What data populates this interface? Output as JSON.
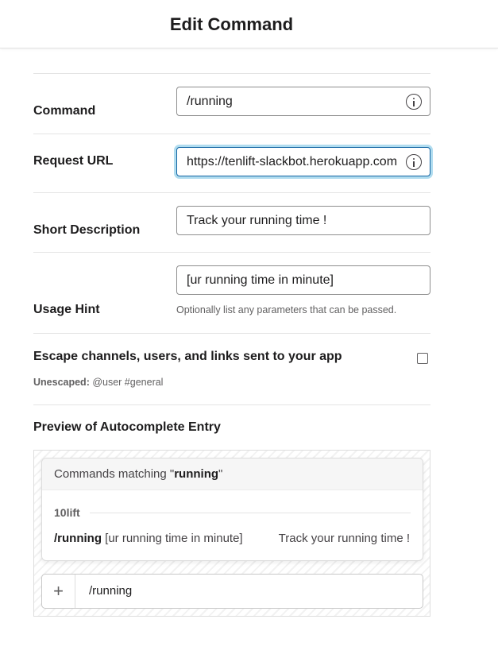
{
  "header": {
    "title": "Edit Command"
  },
  "form": {
    "command": {
      "label": "Command",
      "value": "/running"
    },
    "request_url": {
      "label": "Request URL",
      "value": "https://tenlift-slackbot.herokuapp.com"
    },
    "short_description": {
      "label": "Short Description",
      "value": "Track your running time !"
    },
    "usage_hint": {
      "label": "Usage Hint",
      "value": "[ur running time in minute]",
      "help": "Optionally list any parameters that can be passed."
    },
    "escape": {
      "label": "Escape channels, users, and links sent to your app",
      "sub_bold": "Unescaped:",
      "sub_text": " @user #general",
      "checked": false
    }
  },
  "preview": {
    "title": "Preview of Autocomplete Entry",
    "matching_prefix": "Commands matching \"",
    "matching_term": "running",
    "matching_suffix": "\"",
    "app_name": "10lift",
    "command": "/running",
    "hint": "[ur running time in minute]",
    "description": "Track your running time !",
    "composer_plus": "+",
    "composer_text": "/running"
  }
}
